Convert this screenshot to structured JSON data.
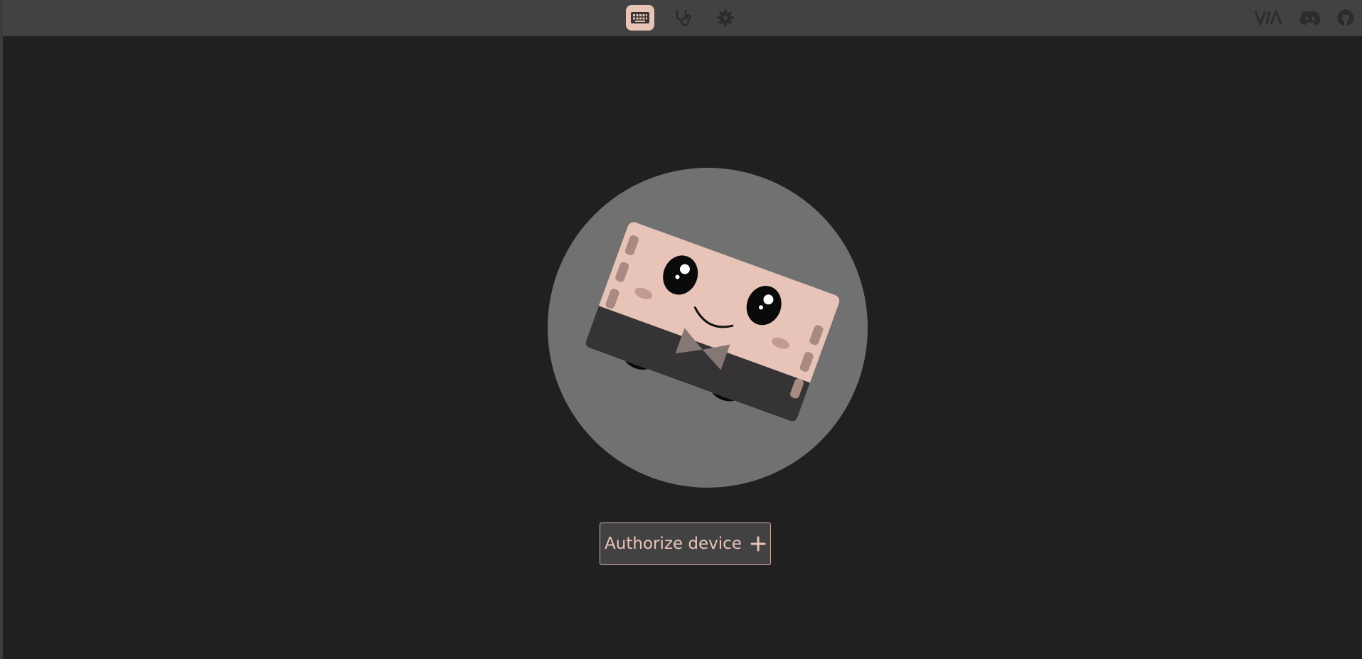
{
  "topbar": {
    "nav": [
      {
        "name": "keyboard",
        "icon": "keyboard-icon",
        "active": true
      },
      {
        "name": "test",
        "icon": "stethoscope-icon",
        "active": false
      },
      {
        "name": "settings",
        "icon": "gear-icon",
        "active": false
      }
    ],
    "links": [
      {
        "name": "via",
        "icon": "via-logo-icon"
      },
      {
        "name": "discord",
        "icon": "discord-icon"
      },
      {
        "name": "github",
        "icon": "github-icon"
      }
    ]
  },
  "main": {
    "illustration": "chippy-mascot-illustration",
    "authorize_label": "Authorize device",
    "authorize_icon": "plus-icon"
  },
  "colors": {
    "background": "#202021",
    "topbar": "#424242",
    "accent": "#e8c4b8",
    "icon_idle": "#2c2c2c",
    "circle": "#717171"
  }
}
